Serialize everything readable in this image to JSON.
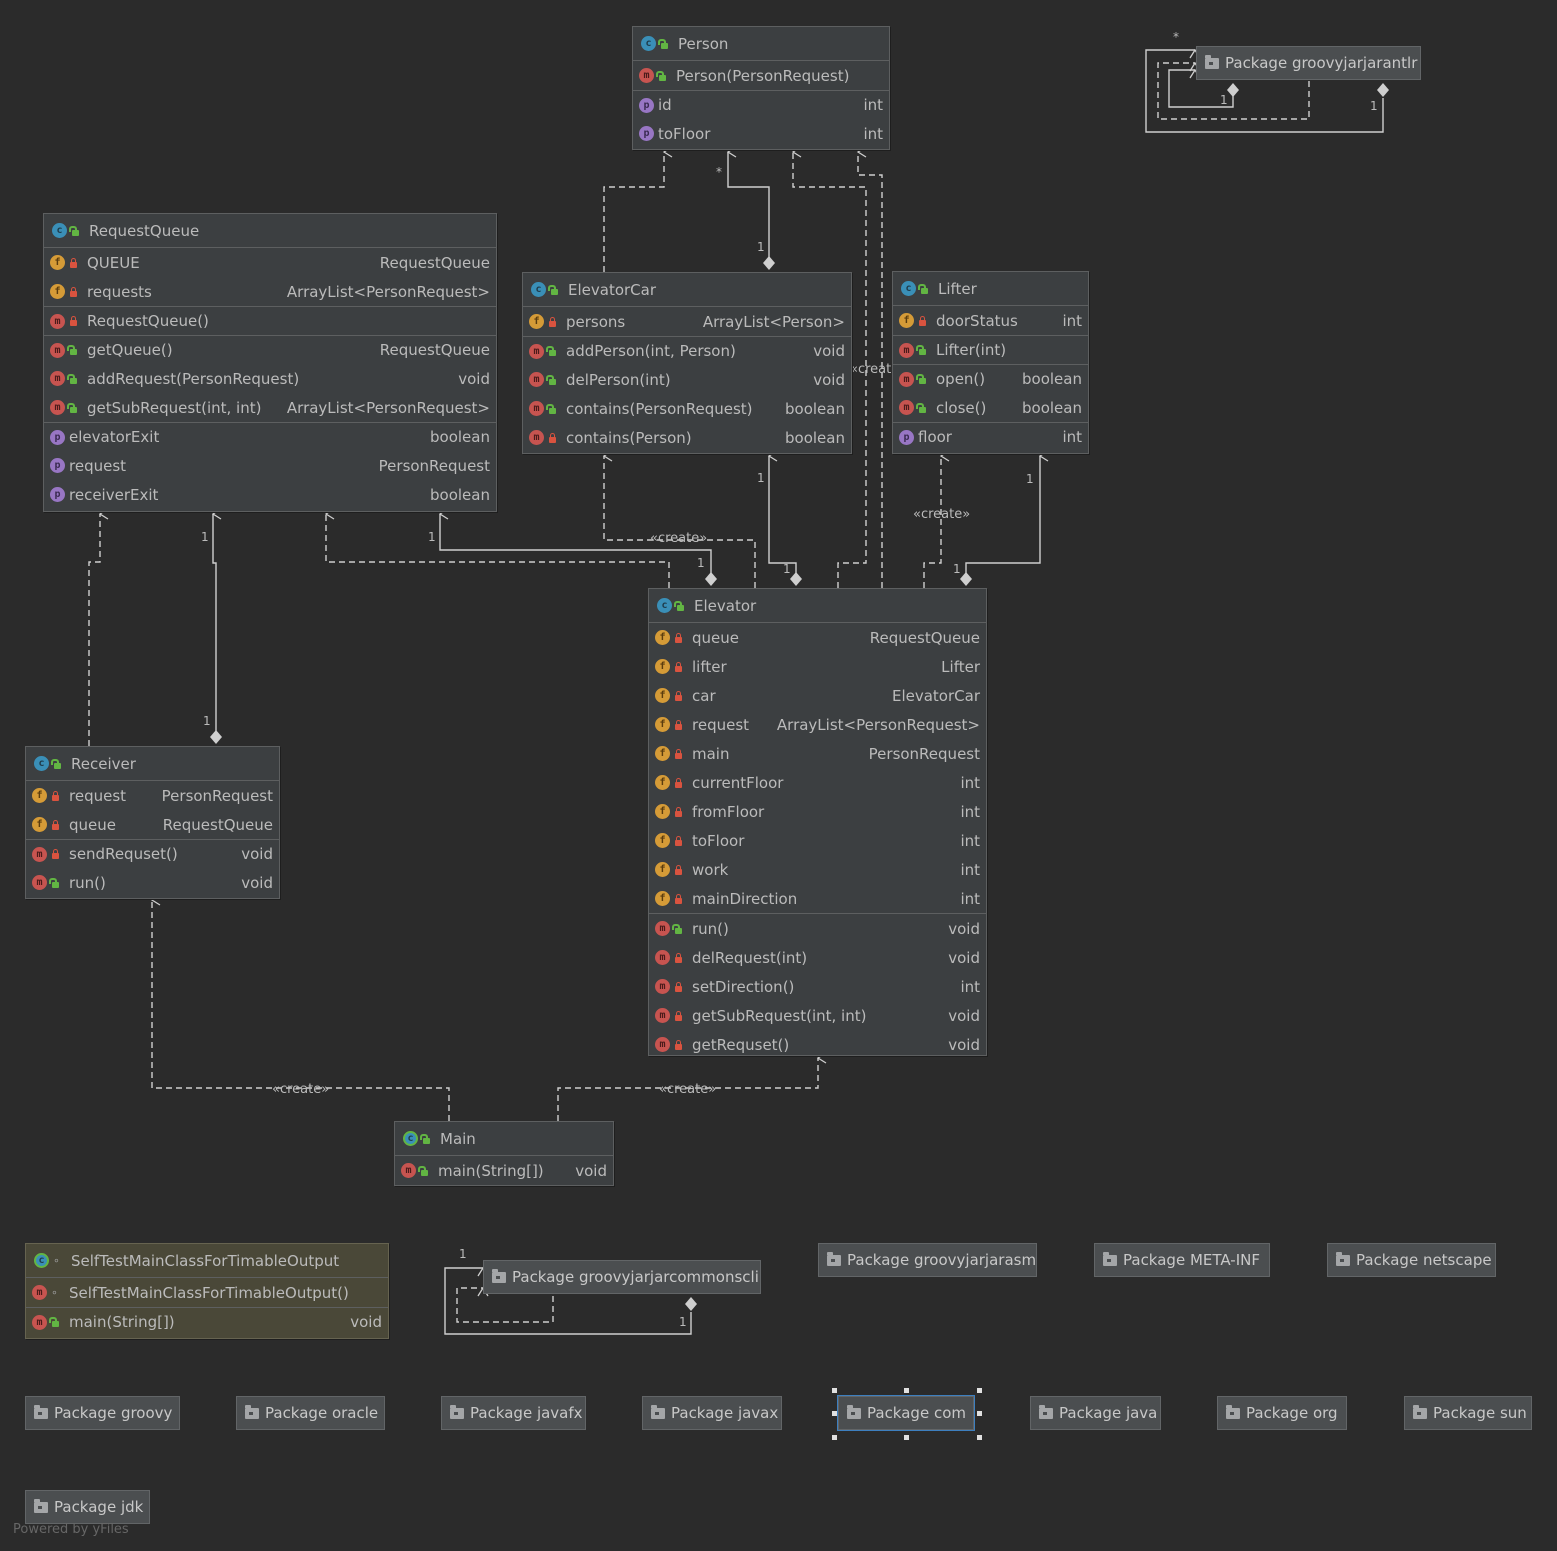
{
  "classes": {
    "person": {
      "name": "Person",
      "ctor": "Person(PersonRequest)",
      "props": [
        {
          "name": "id",
          "type": "int"
        },
        {
          "name": "toFloor",
          "type": "int"
        }
      ]
    },
    "request_queue": {
      "name": "RequestQueue",
      "fields": [
        {
          "name": "QUEUE",
          "type": "RequestQueue"
        },
        {
          "name": "requests",
          "type": "ArrayList<PersonRequest>"
        }
      ],
      "ctor": "RequestQueue()",
      "methods": [
        {
          "name": "getQueue()",
          "type": "RequestQueue"
        },
        {
          "name": "addRequest(PersonRequest)",
          "type": "void"
        },
        {
          "name": "getSubRequest(int, int)",
          "type": "ArrayList<PersonRequest>"
        }
      ],
      "props": [
        {
          "name": "elevatorExit",
          "type": "boolean"
        },
        {
          "name": "request",
          "type": "PersonRequest"
        },
        {
          "name": "receiverExit",
          "type": "boolean"
        }
      ]
    },
    "elevator_car": {
      "name": "ElevatorCar",
      "fields": [
        {
          "name": "persons",
          "type": "ArrayList<Person>"
        }
      ],
      "methods": [
        {
          "name": "addPerson(int, Person)",
          "type": "void"
        },
        {
          "name": "delPerson(int)",
          "type": "void"
        },
        {
          "name": "contains(PersonRequest)",
          "type": "boolean"
        },
        {
          "name": "contains(Person)",
          "type": "boolean"
        }
      ]
    },
    "lifter": {
      "name": "Lifter",
      "fields": [
        {
          "name": "doorStatus",
          "type": "int"
        }
      ],
      "ctor": "Lifter(int)",
      "methods": [
        {
          "name": "open()",
          "type": "boolean"
        },
        {
          "name": "close()",
          "type": "boolean"
        }
      ],
      "props": [
        {
          "name": "floor",
          "type": "int"
        }
      ]
    },
    "elevator": {
      "name": "Elevator",
      "fields": [
        {
          "name": "queue",
          "type": "RequestQueue"
        },
        {
          "name": "lifter",
          "type": "Lifter"
        },
        {
          "name": "car",
          "type": "ElevatorCar"
        },
        {
          "name": "request",
          "type": "ArrayList<PersonRequest>"
        },
        {
          "name": "main",
          "type": "PersonRequest"
        },
        {
          "name": "currentFloor",
          "type": "int"
        },
        {
          "name": "fromFloor",
          "type": "int"
        },
        {
          "name": "toFloor",
          "type": "int"
        },
        {
          "name": "work",
          "type": "int"
        },
        {
          "name": "mainDirection",
          "type": "int"
        }
      ],
      "methods": [
        {
          "name": "run()",
          "type": "void"
        },
        {
          "name": "delRequest(int)",
          "type": "void"
        },
        {
          "name": "setDirection()",
          "type": "int"
        },
        {
          "name": "getSubRequest(int, int)",
          "type": "void"
        },
        {
          "name": "getRequset()",
          "type": "void"
        }
      ]
    },
    "receiver": {
      "name": "Receiver",
      "fields": [
        {
          "name": "request",
          "type": "PersonRequest"
        },
        {
          "name": "queue",
          "type": "RequestQueue"
        }
      ],
      "methods": [
        {
          "name": "sendRequset()",
          "type": "void"
        },
        {
          "name": "run()",
          "type": "void"
        }
      ]
    },
    "main": {
      "name": "Main",
      "methods": [
        {
          "name": "main(String[])",
          "type": "void"
        }
      ]
    },
    "selftest": {
      "name": "SelfTestMainClassForTimableOutput",
      "ctor": "SelfTestMainClassForTimableOutput()",
      "methods": [
        {
          "name": "main(String[])",
          "type": "void"
        }
      ]
    }
  },
  "packages": {
    "groovyjarjarantlr": "Package groovyjarjarantlr",
    "groovyjarjarcommonscli": "Package groovyjarjarcommonscli",
    "groovyjarjarasm": "Package groovyjarjarasm",
    "meta_inf": "Package META-INF",
    "netscape": "Package netscape",
    "groovy": "Package groovy",
    "oracle": "Package oracle",
    "javafx": "Package javafx",
    "javax": "Package javax",
    "com": "Package com",
    "java": "Package java",
    "org": "Package org",
    "sun": "Package sun",
    "jdk": "Package jdk"
  },
  "edge_labels": {
    "create": "«create»",
    "one": "1",
    "many": "*"
  },
  "icons": {
    "class": "class-icon",
    "field": "field-icon",
    "method": "method-icon",
    "property": "property-icon",
    "package": "folder-icon",
    "public": "public-lock-icon",
    "private": "private-lock-icon"
  },
  "colors": {
    "background": "#2b2b2b",
    "node": "#3c3f41",
    "class_icon": "#3a8fb7",
    "field_icon": "#d59b37",
    "method_icon": "#c75450",
    "property_icon": "#9876c4",
    "public": "#62b543",
    "private": "#d9533f",
    "selection": "#3d7fbf"
  },
  "footer": "Powered by yFiles"
}
